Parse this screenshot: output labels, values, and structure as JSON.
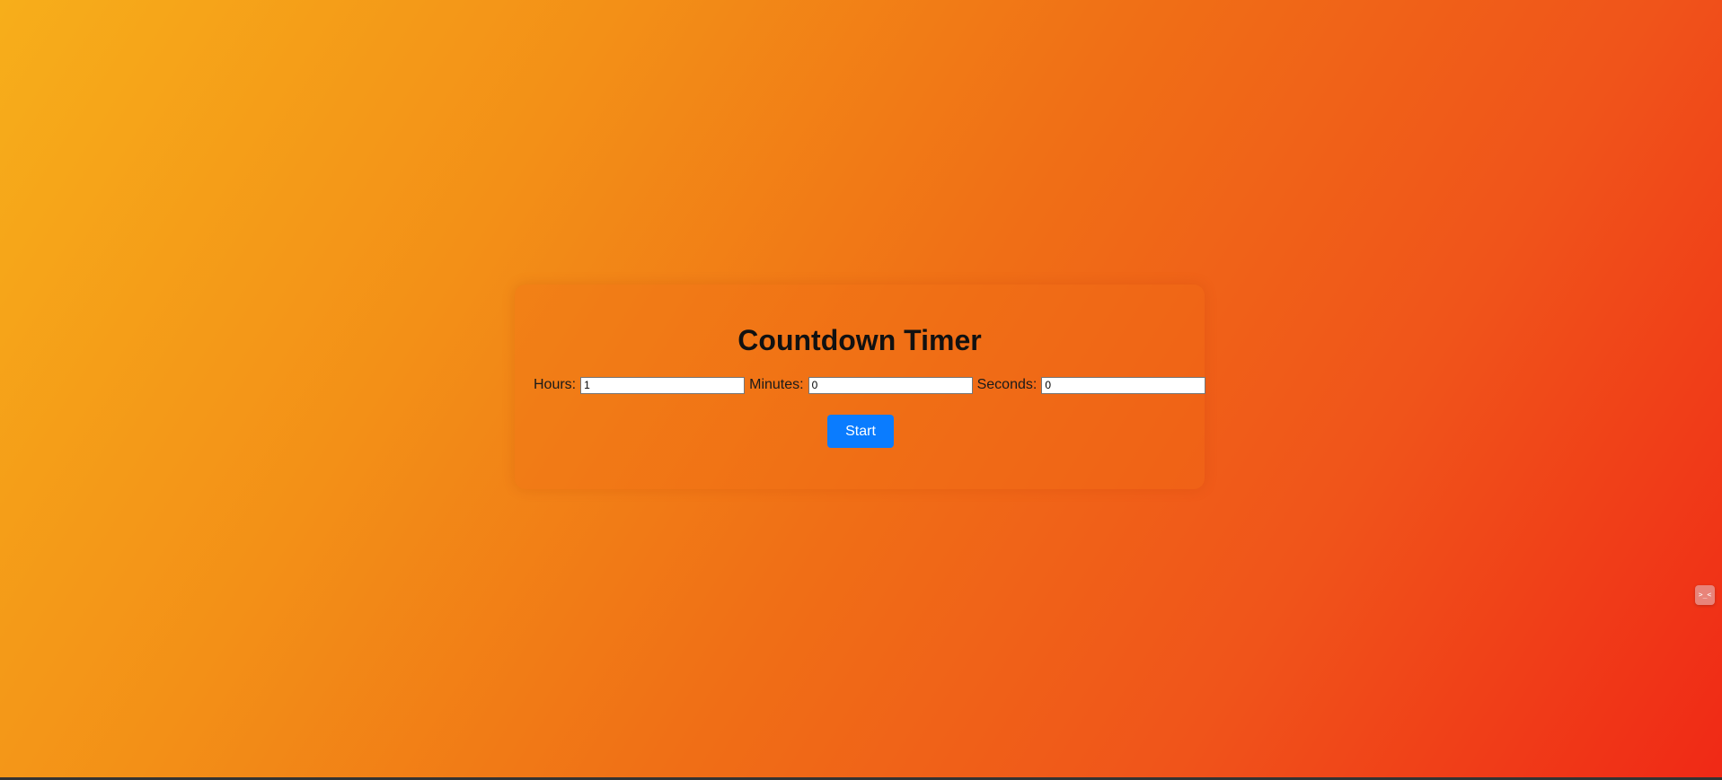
{
  "timer": {
    "title": "Countdown Timer",
    "hours_label": "Hours:",
    "hours_value": "1",
    "minutes_label": "Minutes:",
    "minutes_value": "0",
    "seconds_label": "Seconds:",
    "seconds_value": "0",
    "start_label": "Start"
  },
  "widget": {
    "icon_name": "face-icon",
    "glyph": ">_<"
  },
  "colors": {
    "gradient_start": "#f7ae1a",
    "gradient_end": "#f02916",
    "button": "#0a7cff"
  }
}
